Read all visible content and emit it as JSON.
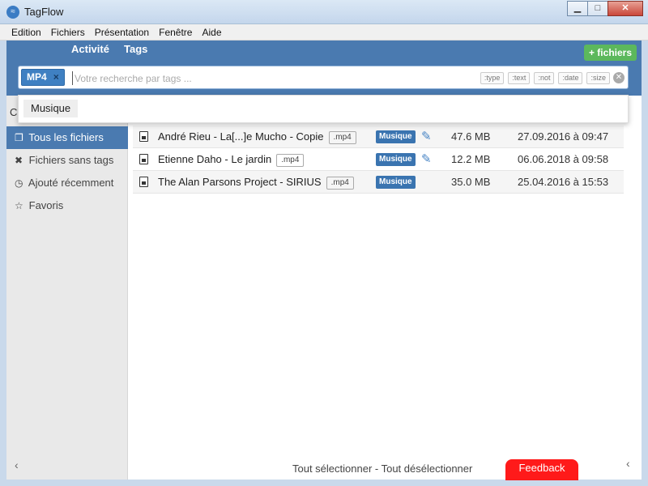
{
  "window": {
    "title": "TagFlow",
    "minimize": "▁",
    "maximize": "□",
    "close": "✕"
  },
  "menu": [
    "Edition",
    "Fichiers",
    "Présentation",
    "Fenêtre",
    "Aide"
  ],
  "header": {
    "tabs": [
      "Activité",
      "Tags"
    ],
    "add_files_label": "+ fichiers"
  },
  "search": {
    "active_tag": "MP4",
    "remove_tag": "×",
    "placeholder": "Votre recherche par tags ...",
    "filters": [
      ":type",
      ":text",
      ":not",
      ":date",
      ":size"
    ],
    "clear": "✕"
  },
  "suggestions": [
    "Musique"
  ],
  "behind_dropdown_text": "C",
  "sidebar": {
    "items": [
      {
        "icon": "copy-icon",
        "glyph": "❐",
        "label": "Tous les fichiers",
        "active": true
      },
      {
        "icon": "times-icon",
        "glyph": "✖",
        "label": "Fichiers sans tags",
        "active": false
      },
      {
        "icon": "clock-icon",
        "glyph": "◷",
        "label": "Ajouté récemment",
        "active": false
      },
      {
        "icon": "star-icon",
        "glyph": "☆",
        "label": "Favoris",
        "active": false
      }
    ],
    "collapse": "‹"
  },
  "files": [
    {
      "name": "André Rieu - La[...]e Mucho - Copie",
      "ext": ".mp4",
      "tag": "Musique",
      "editable": true,
      "size": "47.6 MB",
      "date": "27.09.2016 à 09:47"
    },
    {
      "name": "Etienne Daho - Le jardin",
      "ext": ".mp4",
      "tag": "Musique",
      "editable": true,
      "size": "12.2 MB",
      "date": "06.06.2018 à 09:58"
    },
    {
      "name": "The Alan Parsons Project - SIRIUS",
      "ext": ".mp4",
      "tag": "Musique",
      "editable": false,
      "size": "35.0 MB",
      "date": "25.04.2016 à 15:53"
    }
  ],
  "footer": {
    "select_actions": "Tout sélectionner - Tout désélectionner",
    "feedback": "Feedback",
    "right_collapse": "‹"
  },
  "colors": {
    "header_blue": "#4a7ab0",
    "accent_green": "#5cb85c",
    "feedback_red": "#ff1a1a"
  }
}
